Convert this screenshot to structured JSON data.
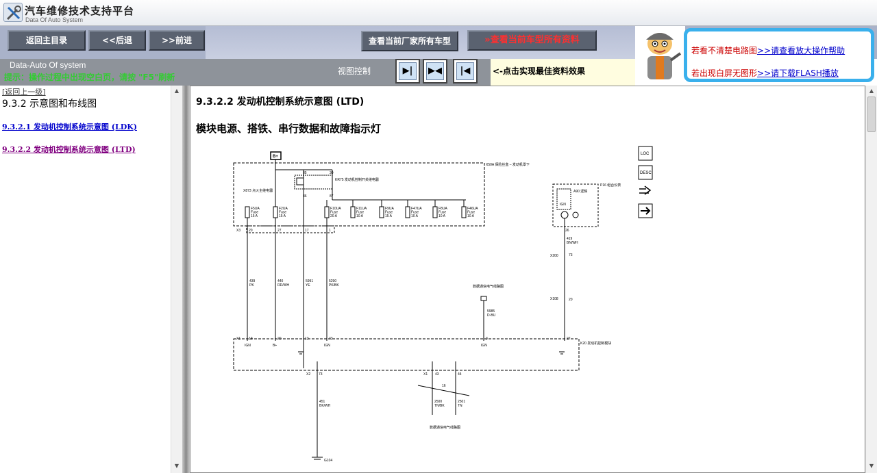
{
  "app": {
    "title": "汽车维修技术支持平台",
    "subtitle": "Data Of Auto System"
  },
  "nav": {
    "main": "返回主目录",
    "back": "<<后退",
    "forward": ">>前进",
    "all_models": "查看当前厂家所有车型",
    "all_docs": "查看当前车型所有资料"
  },
  "info": {
    "brand": "Data-Auto Of system",
    "hint": "提示：操作过程中出现空白页，请按 \"F5\"刷新",
    "view_label": "视图控制",
    "effect": "<-点击实现最佳资料效果"
  },
  "help": {
    "line1_prefix": "若看不清楚电路图",
    "line1_link": ">>请查看放大操作帮助",
    "line2_prefix": "若出现白屏无图形",
    "line2_link": ">>请下载FLASH播放"
  },
  "left": {
    "back_up": "[返回上一级]",
    "section": "9.3.2 示意图和布线图",
    "items": [
      "9.3.2.1 发动机控制系统示意图 (LDK)",
      "9.3.2.2 发动机控制系统示意图 (LTD)"
    ]
  },
  "doc": {
    "title": "9.3.2.2 发动机控制系统示意图 (LTD)",
    "subtitle": "模块电源、搭铁、串行数据和故障指示灯"
  },
  "diagram": {
    "b_plus": "B+",
    "x50a": "X50A 保险丝盒 – 发动机罩下",
    "kr75": "KR75 发动机控制开关继电器",
    "k73": "X873 点火主继电器",
    "relay_pins": [
      "85",
      "30",
      "86",
      "87"
    ],
    "fuses": [
      {
        "name": "F5UA",
        "type": "Fuse",
        "rating": "15 A"
      },
      {
        "name": "F2UA",
        "type": "Fuse",
        "rating": "15 A"
      },
      {
        "name": "F10UA",
        "type": "Fuse",
        "rating": "20 A"
      },
      {
        "name": "F11UA",
        "type": "Fuse",
        "rating": "10 A"
      },
      {
        "name": "F9UA",
        "type": "Fuse",
        "rating": "15 A"
      },
      {
        "name": "F47UA",
        "type": "Fuse",
        "rating": "10 A"
      },
      {
        "name": "F8UA",
        "type": "Fuse",
        "rating": "10 A"
      },
      {
        "name": "F46UA",
        "type": "Fuse",
        "rating": "10 A"
      }
    ],
    "x3_pins": [
      "X3",
      "20",
      "27",
      "17",
      "1"
    ],
    "wires": [
      {
        "num": "439",
        "color": "PK"
      },
      {
        "num": "440",
        "color": "RD/WH"
      },
      {
        "num": "5991",
        "color": "YE"
      },
      {
        "num": "5290",
        "color": "PK/BK"
      },
      {
        "num": "5985",
        "color": "D-BU"
      },
      {
        "num": "419",
        "color": "BN/WH"
      },
      {
        "num": "451",
        "color": "BK/WH"
      },
      {
        "num": "2500",
        "color": "TN/BK"
      },
      {
        "num": "2501",
        "color": "TN"
      }
    ],
    "serial_label": "数据通信电气线路图",
    "p16": "P16 组合仪表",
    "a90": "A90 逻辑",
    "ign": "IGN",
    "p16_pin": "26",
    "x200": "X200",
    "x200_pin": "73",
    "x108": "X108",
    "x108_pin": "20",
    "k20": "K20 发动机控制模块",
    "x1_pins": [
      "X1",
      "19",
      "20",
      "13",
      "73",
      "3",
      "27"
    ],
    "x1_labels": [
      "IGN",
      "B+",
      "IGN",
      "IGN"
    ],
    "x2_pin": [
      "X2",
      "73"
    ],
    "x1b_pins": [
      "X1",
      "43",
      "44"
    ],
    "twist": "16",
    "g104": "G104"
  },
  "legend_icons": [
    "loc-icon",
    "desc-icon",
    "connector-icon",
    "arrow-icon"
  ]
}
